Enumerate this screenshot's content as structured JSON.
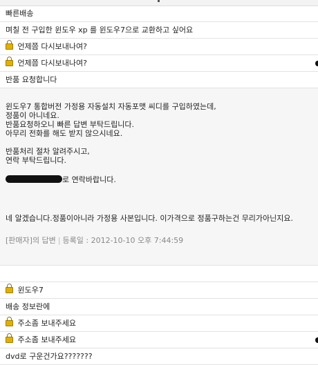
{
  "rows_before": [
    {
      "text": "빠른배송",
      "locked": false
    },
    {
      "text": "며칠 전 구입한 윈도우 xp 를 윈도우7으로 교환하고 싶어요",
      "locked": false
    },
    {
      "text": "언제쯤 다시보내나여?",
      "locked": true
    },
    {
      "text": "언제쯤 다시보내나여?",
      "locked": true
    },
    {
      "text": "반품 요청합니다",
      "locked": false
    }
  ],
  "expanded": {
    "question_lines": [
      "윈도우7 통합버전 가정용 자동설치 자동포맷 씨디를 구입하였는데,",
      "정품이 아니네요.",
      "반품요청하오니 빠른 답변 부탁드립니다.",
      "아무리 전화를 해도 받지 않으시네요.",
      "",
      "반품처리 절차 알려주시고,",
      "연락 부탁드립니다."
    ],
    "contact_suffix": "로 연락바랍니다.",
    "answer_text": "네 알겠습니다.정품이아니라 가정용 사본입니다. 이가격으로 정품구하는건 무리가아닌지요.",
    "answer_meta": {
      "label": "[판매자]의 답변",
      "separator": "|",
      "date_label": "등록일 : 2012-10-10 오후 7:44:59"
    }
  },
  "rows_after": [
    {
      "text": "윈도우7",
      "locked": true
    },
    {
      "text": "배송 정보란에",
      "locked": false
    },
    {
      "text": "주소좀 보내주세요",
      "locked": true
    },
    {
      "text": "주소좀 보내주세요",
      "locked": true
    },
    {
      "text": "dvd로 구운건가요???????",
      "locked": false
    }
  ]
}
